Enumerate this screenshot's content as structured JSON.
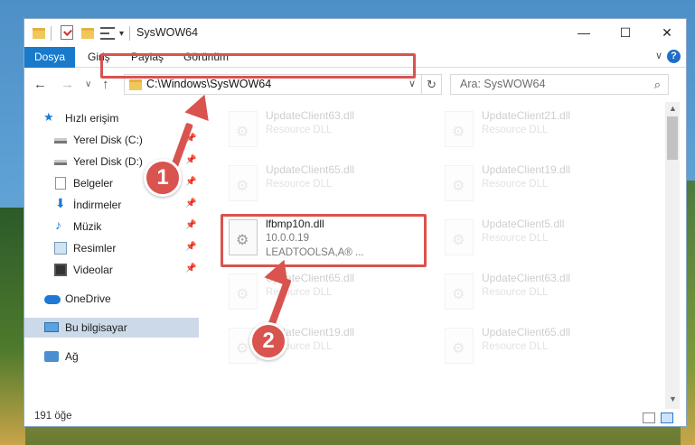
{
  "window": {
    "title": "SysWOW64",
    "min_icon": "—",
    "max_icon": "☐",
    "close_icon": "✕"
  },
  "quick_access_toolbar": {
    "dropdown_icon": "▾"
  },
  "ribbon": {
    "tabs": [
      "Dosya",
      "Giriş",
      "Paylaş",
      "Görünüm"
    ],
    "expand_icon": "∨",
    "help_icon": "?"
  },
  "nav": {
    "back_icon": "←",
    "forward_icon": "→",
    "recent_icon": "∨",
    "up_icon": "↑"
  },
  "address": {
    "path": "C:\\Windows\\SysWOW64",
    "dropdown_icon": "∨",
    "refresh_icon": "↻"
  },
  "search": {
    "placeholder": "Ara: SysWOW64",
    "icon": "⌕"
  },
  "sidebar": {
    "items": [
      {
        "label": "Hızlı erişim",
        "icon": "star-icon",
        "glyph": "★"
      },
      {
        "label": "Yerel Disk (C:)",
        "icon": "drive-icon",
        "pin": "📌"
      },
      {
        "label": "Yerel Disk (D:)",
        "icon": "drive-icon",
        "pin": "📌"
      },
      {
        "label": "Belgeler",
        "icon": "document-icon",
        "pin": "📌"
      },
      {
        "label": "İndirmeler",
        "icon": "download-icon",
        "glyph": "⬇",
        "pin": "📌"
      },
      {
        "label": "Müzik",
        "icon": "music-icon",
        "glyph": "♪",
        "pin": "📌"
      },
      {
        "label": "Resimler",
        "icon": "pictures-icon",
        "pin": "📌"
      },
      {
        "label": "Videolar",
        "icon": "videos-icon",
        "pin": "📌"
      },
      {
        "label": "OneDrive",
        "icon": "cloud-icon"
      },
      {
        "label": "Bu bilgisayar",
        "icon": "computer-icon"
      },
      {
        "label": "Ağ",
        "icon": "network-icon"
      }
    ]
  },
  "files": [
    {
      "name": "UpdateClient63.dll",
      "desc": "Resource DLL"
    },
    {
      "name": "UpdateClient21.dll",
      "desc": "Resource DLL"
    },
    {
      "name": "UpdateClient65.dll",
      "desc": "Resource DLL"
    },
    {
      "name": "UpdateClient19.dll",
      "desc": "Resource DLL"
    },
    {
      "name": "lfbmp10n.dll",
      "desc": "10.0.0.19",
      "company": "LEADTOOLSA,A® ..."
    },
    {
      "name": "UpdateClient5.dll",
      "desc": "Resource DLL"
    },
    {
      "name": "UpdateClient65.dll",
      "desc": "Resource DLL"
    },
    {
      "name": "UpdateClient63.dll",
      "desc": "Resource DLL"
    },
    {
      "name": "UpdateClient19.dll",
      "desc": "Resource DLL"
    },
    {
      "name": "UpdateClient65.dll",
      "desc": "Resource DLL"
    }
  ],
  "status": {
    "item_count": "191 öğe"
  },
  "annotations": {
    "badge1": "1",
    "badge2": "2"
  },
  "colors": {
    "accent": "#1979ca",
    "highlight": "#d9534f"
  }
}
